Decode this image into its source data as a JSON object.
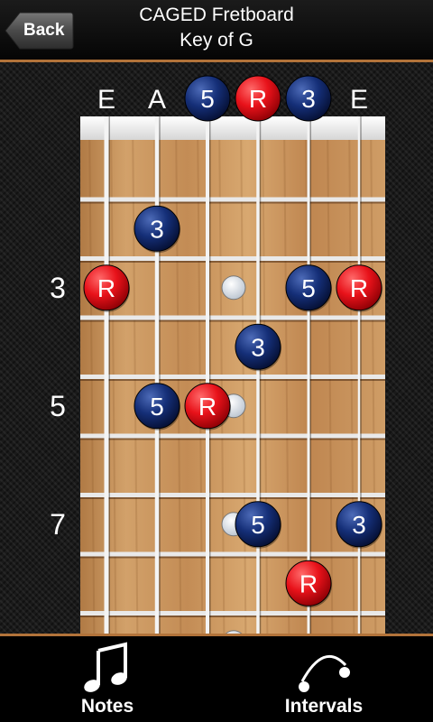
{
  "header": {
    "back_label": "Back",
    "title": "CAGED Fretboard",
    "subtitle": "Key of G"
  },
  "fretboard": {
    "string_labels": [
      "E",
      "A",
      "5",
      "R",
      "3",
      "E"
    ],
    "fret_numbers": [
      "3",
      "5",
      "7"
    ],
    "notes": [
      {
        "string": 2,
        "fret": 2,
        "label": "3",
        "kind": "interval"
      },
      {
        "string": 1,
        "fret": 3,
        "label": "R",
        "kind": "root"
      },
      {
        "string": 5,
        "fret": 3,
        "label": "5",
        "kind": "interval"
      },
      {
        "string": 6,
        "fret": 3,
        "label": "R",
        "kind": "root"
      },
      {
        "string": 4,
        "fret": 4,
        "label": "3",
        "kind": "interval"
      },
      {
        "string": 2,
        "fret": 5,
        "label": "5",
        "kind": "interval"
      },
      {
        "string": 3,
        "fret": 5,
        "label": "R",
        "kind": "root"
      },
      {
        "string": 4,
        "fret": 7,
        "label": "5",
        "kind": "interval"
      },
      {
        "string": 6,
        "fret": 7,
        "label": "3",
        "kind": "interval"
      },
      {
        "string": 5,
        "fret": 8,
        "label": "R",
        "kind": "root"
      }
    ],
    "colors": {
      "root": "#e8121a",
      "interval": "#0e2a6e",
      "wood": "#c8935a"
    }
  },
  "tabbar": {
    "tabs": [
      {
        "id": "notes",
        "label": "Notes",
        "icon": "music-note-icon"
      },
      {
        "id": "intervals",
        "label": "Intervals",
        "icon": "intervals-arc-icon"
      }
    ]
  }
}
